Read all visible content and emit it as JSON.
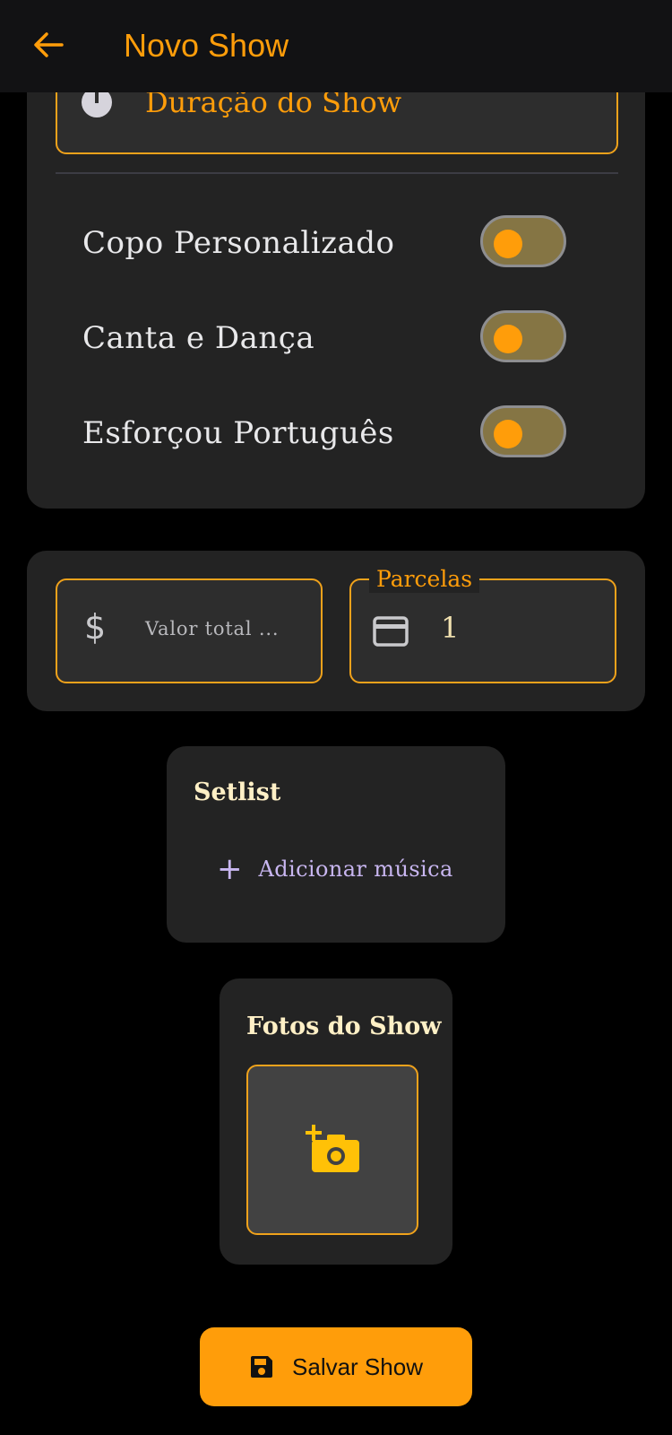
{
  "appbar": {
    "title": "Novo Show",
    "back_icon": "arrow-left-icon"
  },
  "details": {
    "duration_label": "Duração do Show",
    "duration_icon": "clock-icon",
    "toggles": [
      {
        "label": "Copo Personalizado",
        "on": false
      },
      {
        "label": "Canta e Dança",
        "on": false
      },
      {
        "label": "Esforçou Português",
        "on": false
      }
    ]
  },
  "payment": {
    "currency_symbol": "$",
    "valor_placeholder": "Valor total ...",
    "parcelas_label": "Parcelas",
    "parcelas_value": "1",
    "card_icon": "credit-card-icon"
  },
  "setlist": {
    "title": "Setlist",
    "add_label": "Adicionar música",
    "add_icon": "plus-icon"
  },
  "photos": {
    "title": "Fotos do Show",
    "add_icon": "add-camera-icon"
  },
  "footer": {
    "save_label": "Salvar Show",
    "save_icon": "floppy-disk-icon"
  },
  "colors": {
    "accent": "#ff9d0a",
    "background": "#000000",
    "card": "#232323",
    "appbar": "#121214",
    "link": "#c8b6f0"
  }
}
